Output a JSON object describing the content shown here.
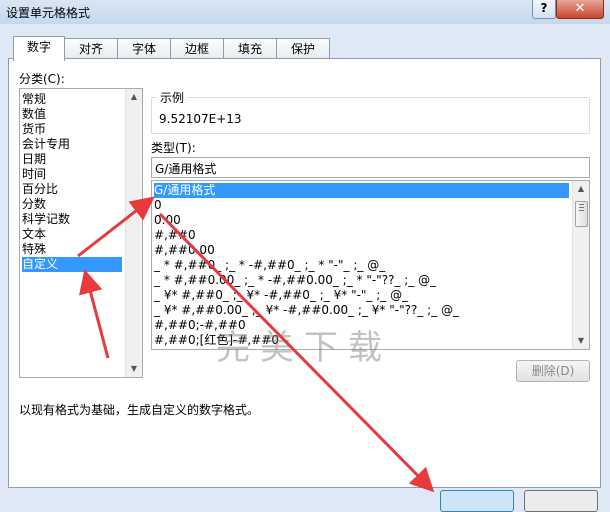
{
  "window": {
    "title": "设置单元格格式",
    "help_label": "?",
    "close_label": "✕"
  },
  "tabs": [
    {
      "label": "数字",
      "active": true
    },
    {
      "label": "对齐"
    },
    {
      "label": "字体"
    },
    {
      "label": "边框"
    },
    {
      "label": "填充"
    },
    {
      "label": "保护"
    }
  ],
  "category": {
    "label": "分类(C):",
    "items": [
      "常规",
      "数值",
      "货币",
      "会计专用",
      "日期",
      "时间",
      "百分比",
      "分数",
      "科学记数",
      "文本",
      "特殊",
      "自定义"
    ],
    "selected": "自定义"
  },
  "sample": {
    "label": "示例",
    "value": "9.52107E+13"
  },
  "type": {
    "label": "类型(T):",
    "input_value": "G/通用格式",
    "items": [
      "G/通用格式",
      "0",
      "0.00",
      "#,##0",
      "#,##0.00",
      "_ * #,##0_ ;_ * -#,##0_ ;_ * \"-\"_ ;_ @_",
      "_ * #,##0.00_ ;_ * -#,##0.00_ ;_ * \"-\"??_ ;_ @_",
      "_ ¥* #,##0_ ;_ ¥* -#,##0_ ;_ ¥* \"-\"_ ;_ @_",
      "_ ¥* #,##0.00_ ;_ ¥* -#,##0.00_ ;_ ¥* \"-\"??_ ;_ @_",
      "#,##0;-#,##0",
      "#,##0;[红色]-#,##0"
    ],
    "selected": "G/通用格式"
  },
  "delete_button": "删除(D)",
  "description": "以现有格式为基础，生成自定义的数字格式。",
  "watermark": "完美下载",
  "colors": {
    "selection": "#3399ff",
    "annotation_arrow": "#e8393b",
    "dialog_bg": "#dfe9f5"
  }
}
